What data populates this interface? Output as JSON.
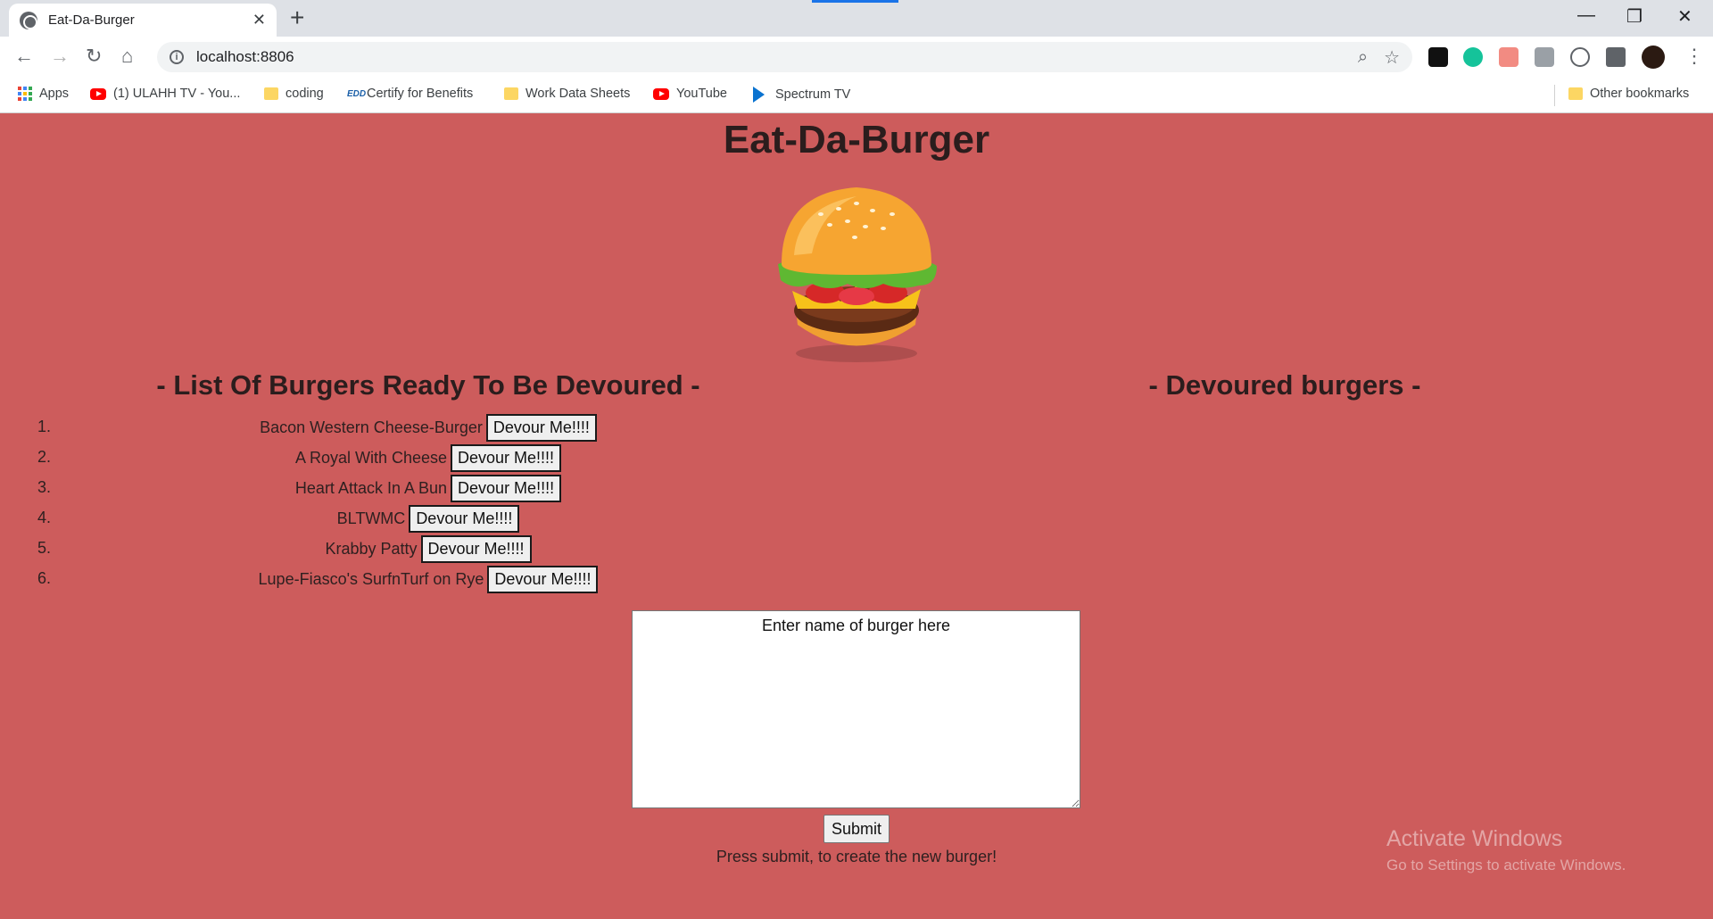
{
  "browser": {
    "tab_title": "Eat-Da-Burger",
    "url": "localhost:8806",
    "bookmarks": [
      {
        "label": "Apps",
        "icon": "apps-grid-icon"
      },
      {
        "label": "(1) ULAHH TV - You...",
        "icon": "youtube-icon"
      },
      {
        "label": "coding",
        "icon": "folder-icon"
      },
      {
        "label": "Certify for Benefits",
        "icon": "edd-icon"
      },
      {
        "label": "Work Data Sheets",
        "icon": "folder-icon"
      },
      {
        "label": "YouTube",
        "icon": "youtube-icon"
      },
      {
        "label": "Spectrum TV",
        "icon": "spectrum-icon"
      }
    ],
    "other_bookmarks": "Other bookmarks"
  },
  "page": {
    "title": "Eat-Da-Burger",
    "ready_heading": "- List Of Burgers Ready To Be Devoured -",
    "devoured_heading": "- Devoured burgers -",
    "devour_label": "Devour Me!!!!",
    "burgers": [
      {
        "num": "1.",
        "name": "Bacon Western Cheese-Burger"
      },
      {
        "num": "2.",
        "name": "A Royal With Cheese"
      },
      {
        "num": "3.",
        "name": "Heart Attack In A Bun"
      },
      {
        "num": "4.",
        "name": "BLTWMC"
      },
      {
        "num": "5.",
        "name": "Krabby Patty"
      },
      {
        "num": "6.",
        "name": "Lupe-Fiasco's SurfnTurf on Rye"
      }
    ],
    "textarea_placeholder": "Enter name of burger here",
    "submit_label": "Submit",
    "helper_text": "Press submit, to create the new burger!"
  },
  "watermark": {
    "title": "Activate Windows",
    "subtitle": "Go to Settings to activate Windows."
  },
  "colors": {
    "page_background": "#cd5c5c",
    "tab_indicator": "#1a73e8"
  }
}
